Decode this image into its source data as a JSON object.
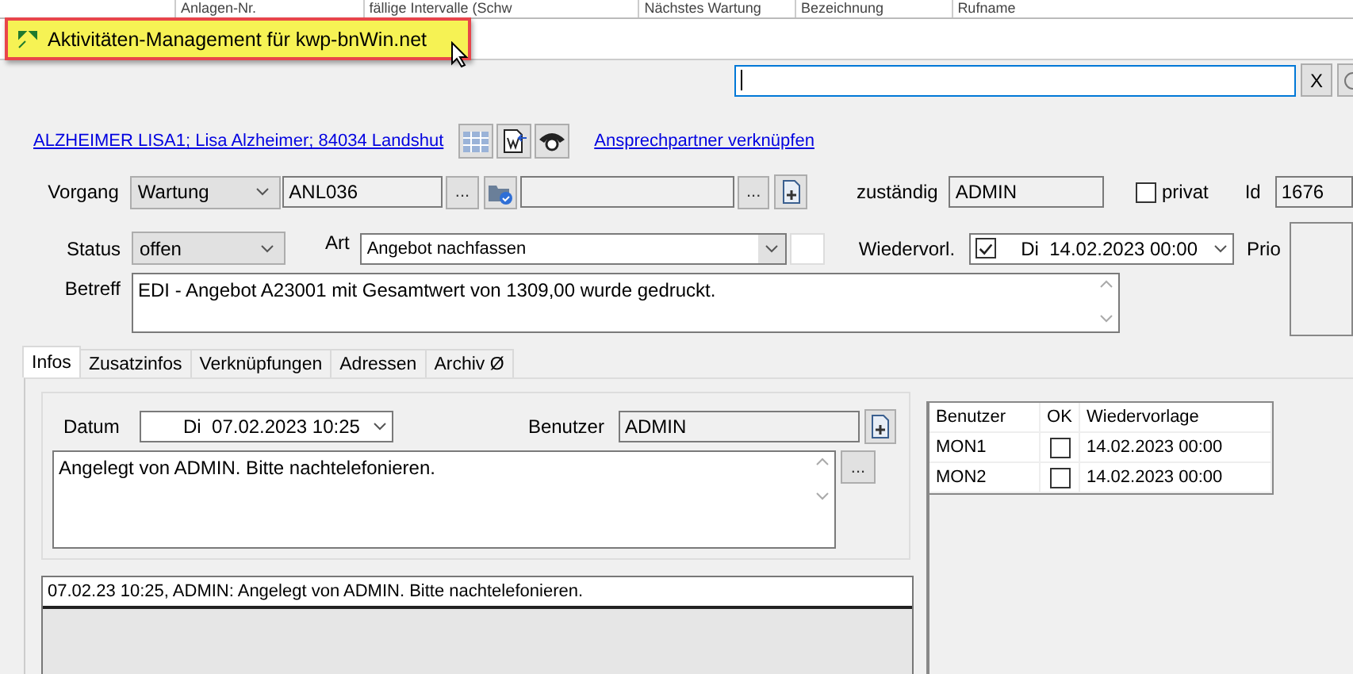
{
  "background_table": {
    "columns": [
      "Anlagen-Nr.",
      "fällige Intervalle (Schw",
      "Nächstes Wartung",
      "Bezeichnung",
      "Rufname"
    ]
  },
  "title_tooltip": "Aktivitäten-Management für kwp-bnWin.net",
  "search": {
    "clear_button": "X"
  },
  "customer_link": "ALZHEIMER LISA1; Lisa Alzheimer; 84034 Landshut",
  "contact_link": "Ansprechpartner verknüpfen",
  "vorgang": {
    "label": "Vorgang",
    "type": "Wartung",
    "reference": "ANL036",
    "browse_button": "...",
    "browse_button_2": "..."
  },
  "zustaendig": {
    "label": "zuständig",
    "value": "ADMIN"
  },
  "privat": {
    "label": "privat",
    "checked": false
  },
  "id": {
    "label": "Id",
    "value": "1676"
  },
  "status": {
    "label": "Status",
    "value": "offen"
  },
  "art": {
    "label": "Art",
    "value": "Angebot nachfassen"
  },
  "wiedervorlage": {
    "label": "Wiedervorl.",
    "checked": true,
    "value": "Di  14.02.2023 00:00"
  },
  "prio": {
    "label": "Prio"
  },
  "betreff": {
    "label": "Betreff",
    "value": "EDI - Angebot A23001 mit Gesamtwert von 1309,00 wurde gedruckt."
  },
  "tabs": [
    {
      "label": "Infos",
      "selected": true
    },
    {
      "label": "Zusatzinfos",
      "selected": false
    },
    {
      "label": "Verknüpfungen",
      "selected": false
    },
    {
      "label": "Adressen",
      "selected": false
    },
    {
      "label": "Archiv Ø",
      "selected": false
    }
  ],
  "infos": {
    "datum_label": "Datum",
    "datum": "Di  07.02.2023 10:25",
    "benutzer_label": "Benutzer",
    "benutzer": "ADMIN",
    "note": "Angelegt von ADMIN. Bitte nachtelefonieren.",
    "more_button": "..."
  },
  "log": [
    "07.02.23 10:25, ADMIN: Angelegt von ADMIN. Bitte nachtelefonieren."
  ],
  "reminders": {
    "columns": [
      "Benutzer",
      "OK",
      "Wiedervorlage"
    ],
    "rows": [
      {
        "user": "MON1",
        "ok": false,
        "date": "14.02.2023 00:00"
      },
      {
        "user": "MON2",
        "ok": false,
        "date": "14.02.2023 00:00"
      }
    ]
  }
}
